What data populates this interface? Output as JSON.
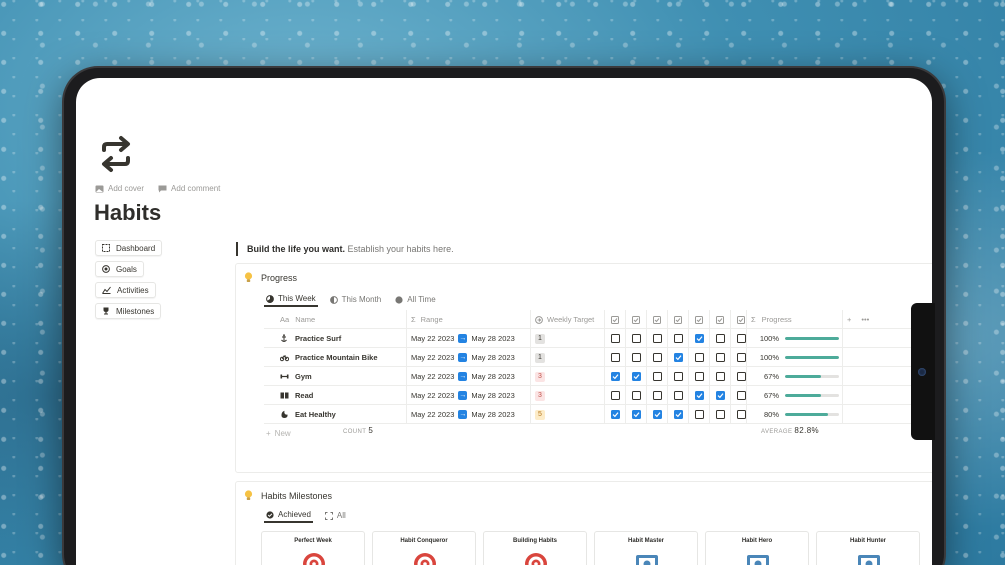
{
  "page": {
    "title": "Habits",
    "icon": "repeat-arrows-icon",
    "add_cover": "Add cover",
    "add_comment": "Add comment"
  },
  "nav": [
    {
      "label": "Dashboard",
      "icon": "dashboard-icon"
    },
    {
      "label": "Goals",
      "icon": "target-icon"
    },
    {
      "label": "Activities",
      "icon": "chart-icon"
    },
    {
      "label": "Milestones",
      "icon": "trophy-icon"
    }
  ],
  "callout": {
    "bold": "Build the life you want.",
    "rest": " Establish your habits here."
  },
  "progress": {
    "title": "Progress",
    "tabs": [
      "This Week",
      "This Month",
      "All Time"
    ],
    "columns": {
      "name": "Name",
      "range": "Range",
      "target": "Weekly Target",
      "progress": "Progress"
    },
    "name_prefix": "Aa",
    "sigma": "Σ",
    "rows": [
      {
        "name": "Practice Surf",
        "start": "May 22 2023",
        "end": "May 28 2023",
        "target": "1",
        "days": [
          false,
          false,
          false,
          false,
          true,
          false,
          false
        ],
        "pct_label": "100%",
        "pct": 1.0
      },
      {
        "name": "Practice Mountain Bike",
        "start": "May 22 2023",
        "end": "May 28 2023",
        "target": "1",
        "days": [
          false,
          false,
          false,
          true,
          false,
          false,
          false
        ],
        "pct_label": "100%",
        "pct": 1.0
      },
      {
        "name": "Gym",
        "start": "May 22 2023",
        "end": "May 28 2023",
        "target": "3",
        "days": [
          true,
          true,
          false,
          false,
          false,
          false,
          false
        ],
        "pct_label": "67%",
        "pct": 0.67
      },
      {
        "name": "Read",
        "start": "May 22 2023",
        "end": "May 28 2023",
        "target": "3",
        "days": [
          false,
          false,
          false,
          false,
          true,
          true,
          false
        ],
        "pct_label": "67%",
        "pct": 0.67
      },
      {
        "name": "Eat Healthy",
        "start": "May 22 2023",
        "end": "May 28 2023",
        "target": "5",
        "days": [
          true,
          true,
          true,
          true,
          false,
          false,
          false
        ],
        "pct_label": "80%",
        "pct": 0.8
      }
    ],
    "new_label": "New",
    "count_label": "COUNT",
    "count_value": "5",
    "average_label": "AVERAGE",
    "average_value": "82.8%"
  },
  "milestones": {
    "title": "Habits Milestones",
    "tabs": [
      "Achieved",
      "All"
    ],
    "cards": [
      "Perfect Week",
      "Habit Conqueror",
      "Building Habits",
      "Habit Master",
      "Habit Hero",
      "Habit Hunter"
    ]
  },
  "colors": {
    "accent": "#2383e2",
    "progress": "#4dab9a"
  }
}
